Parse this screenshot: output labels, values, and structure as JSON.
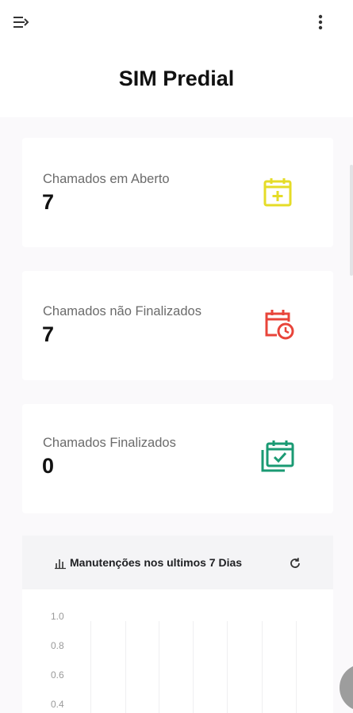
{
  "app": {
    "title": "SIM Predial"
  },
  "topbar": {
    "menu_icon": "menu-arrow-icon",
    "more_icon": "more-vertical-icon"
  },
  "cards": [
    {
      "label": "Chamados em Aberto",
      "value": "7",
      "icon": "calendar-plus-icon",
      "color": "#e5dc27"
    },
    {
      "label": "Chamados não Finalizados",
      "value": "7",
      "icon": "calendar-clock-icon",
      "color": "#e8443a"
    },
    {
      "label": "Chamados Finalizados",
      "value": "0",
      "icon": "calendar-check-stack-icon",
      "color": "#1a9a73"
    }
  ],
  "chart_panel": {
    "title": "Manutenções nos ultimos 7 Dias",
    "icon": "chart-icon",
    "refresh_icon": "refresh-icon"
  },
  "chart_data": {
    "type": "line",
    "title": "Manutenções nos ultimos 7 Dias",
    "y_ticks": [
      "1.0",
      "0.8",
      "0.6",
      "0.4"
    ],
    "series": [],
    "grid": true
  }
}
